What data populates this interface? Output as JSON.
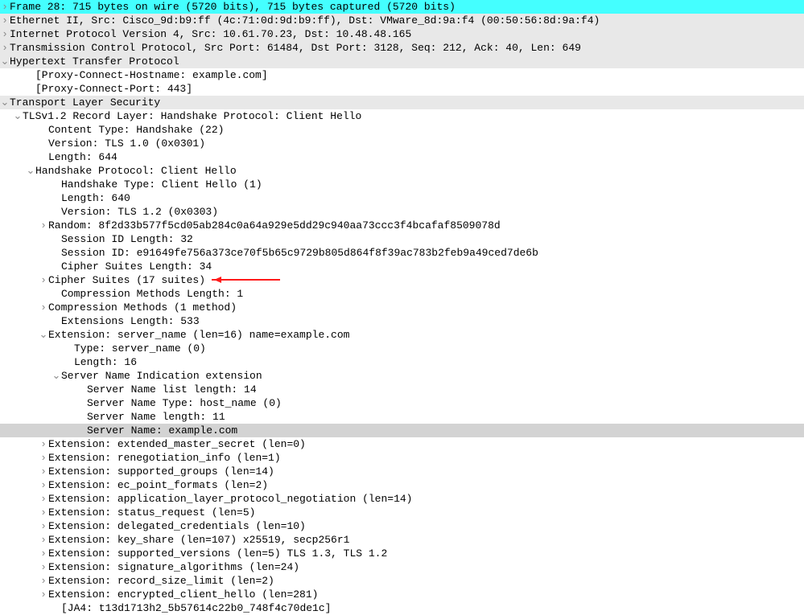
{
  "lines": [
    {
      "indent": 0,
      "tw": "right",
      "hl": "cyan",
      "text": "Frame 28: 715 bytes on wire (5720 bits), 715 bytes captured (5720 bits)"
    },
    {
      "indent": 0,
      "tw": "right",
      "hl": "grey",
      "text": "Ethernet II, Src: Cisco_9d:b9:ff (4c:71:0d:9d:b9:ff), Dst: VMware_8d:9a:f4 (00:50:56:8d:9a:f4)"
    },
    {
      "indent": 0,
      "tw": "right",
      "hl": "grey",
      "text": "Internet Protocol Version 4, Src: 10.61.70.23, Dst: 10.48.48.165"
    },
    {
      "indent": 0,
      "tw": "right",
      "hl": "grey",
      "text": "Transmission Control Protocol, Src Port: 61484, Dst Port: 3128, Seq: 212, Ack: 40, Len: 649"
    },
    {
      "indent": 0,
      "tw": "down",
      "hl": "grey",
      "text": "Hypertext Transfer Protocol"
    },
    {
      "indent": 2,
      "tw": "none",
      "text": "[Proxy-Connect-Hostname: example.com]"
    },
    {
      "indent": 2,
      "tw": "none",
      "text": "[Proxy-Connect-Port: 443]"
    },
    {
      "indent": 0,
      "tw": "down",
      "hl": "grey",
      "text": "Transport Layer Security"
    },
    {
      "indent": 1,
      "tw": "down",
      "text": "TLSv1.2 Record Layer: Handshake Protocol: Client Hello"
    },
    {
      "indent": 3,
      "tw": "none",
      "text": "Content Type: Handshake (22)"
    },
    {
      "indent": 3,
      "tw": "none",
      "text": "Version: TLS 1.0 (0x0301)"
    },
    {
      "indent": 3,
      "tw": "none",
      "text": "Length: 644"
    },
    {
      "indent": 2,
      "tw": "down",
      "text": "Handshake Protocol: Client Hello"
    },
    {
      "indent": 4,
      "tw": "none",
      "text": "Handshake Type: Client Hello (1)"
    },
    {
      "indent": 4,
      "tw": "none",
      "text": "Length: 640"
    },
    {
      "indent": 4,
      "tw": "none",
      "text": "Version: TLS 1.2 (0x0303)"
    },
    {
      "indent": 3,
      "tw": "right",
      "text": "Random: 8f2d33b577f5cd05ab284c0a64a929e5dd29c940aa73ccc3f4bcafaf8509078d"
    },
    {
      "indent": 4,
      "tw": "none",
      "text": "Session ID Length: 32"
    },
    {
      "indent": 4,
      "tw": "none",
      "text": "Session ID: e91649fe756a373ce70f5b65c9729b805d864f8f39ac783b2feb9a49ced7de6b"
    },
    {
      "indent": 4,
      "tw": "none",
      "text": "Cipher Suites Length: 34"
    },
    {
      "indent": 3,
      "tw": "right",
      "text": "Cipher Suites (17 suites)",
      "arrow": true
    },
    {
      "indent": 4,
      "tw": "none",
      "text": "Compression Methods Length: 1"
    },
    {
      "indent": 3,
      "tw": "right",
      "text": "Compression Methods (1 method)"
    },
    {
      "indent": 4,
      "tw": "none",
      "text": "Extensions Length: 533"
    },
    {
      "indent": 3,
      "tw": "down",
      "text": "Extension: server_name (len=16) name=example.com"
    },
    {
      "indent": 5,
      "tw": "none",
      "text": "Type: server_name (0)"
    },
    {
      "indent": 5,
      "tw": "none",
      "text": "Length: 16"
    },
    {
      "indent": 4,
      "tw": "down",
      "text": "Server Name Indication extension"
    },
    {
      "indent": 6,
      "tw": "none",
      "text": "Server Name list length: 14"
    },
    {
      "indent": 6,
      "tw": "none",
      "text": "Server Name Type: host_name (0)"
    },
    {
      "indent": 6,
      "tw": "none",
      "text": "Server Name length: 11"
    },
    {
      "indent": 6,
      "tw": "none",
      "hl": "sel",
      "text": "Server Name: example.com"
    },
    {
      "indent": 3,
      "tw": "right",
      "text": "Extension: extended_master_secret (len=0)"
    },
    {
      "indent": 3,
      "tw": "right",
      "text": "Extension: renegotiation_info (len=1)"
    },
    {
      "indent": 3,
      "tw": "right",
      "text": "Extension: supported_groups (len=14)"
    },
    {
      "indent": 3,
      "tw": "right",
      "text": "Extension: ec_point_formats (len=2)"
    },
    {
      "indent": 3,
      "tw": "right",
      "text": "Extension: application_layer_protocol_negotiation (len=14)"
    },
    {
      "indent": 3,
      "tw": "right",
      "text": "Extension: status_request (len=5)"
    },
    {
      "indent": 3,
      "tw": "right",
      "text": "Extension: delegated_credentials (len=10)"
    },
    {
      "indent": 3,
      "tw": "right",
      "text": "Extension: key_share (len=107) x25519, secp256r1"
    },
    {
      "indent": 3,
      "tw": "right",
      "text": "Extension: supported_versions (len=5) TLS 1.3, TLS 1.2"
    },
    {
      "indent": 3,
      "tw": "right",
      "text": "Extension: signature_algorithms (len=24)"
    },
    {
      "indent": 3,
      "tw": "right",
      "text": "Extension: record_size_limit (len=2)"
    },
    {
      "indent": 3,
      "tw": "right",
      "text": "Extension: encrypted_client_hello (len=281)"
    },
    {
      "indent": 4,
      "tw": "none",
      "text": "[JA4: t13d1713h2_5b57614c22b0_748f4c70de1c]",
      "cut": true
    }
  ],
  "glyphs": {
    "right": "›",
    "down": "⌄",
    "none": ""
  }
}
